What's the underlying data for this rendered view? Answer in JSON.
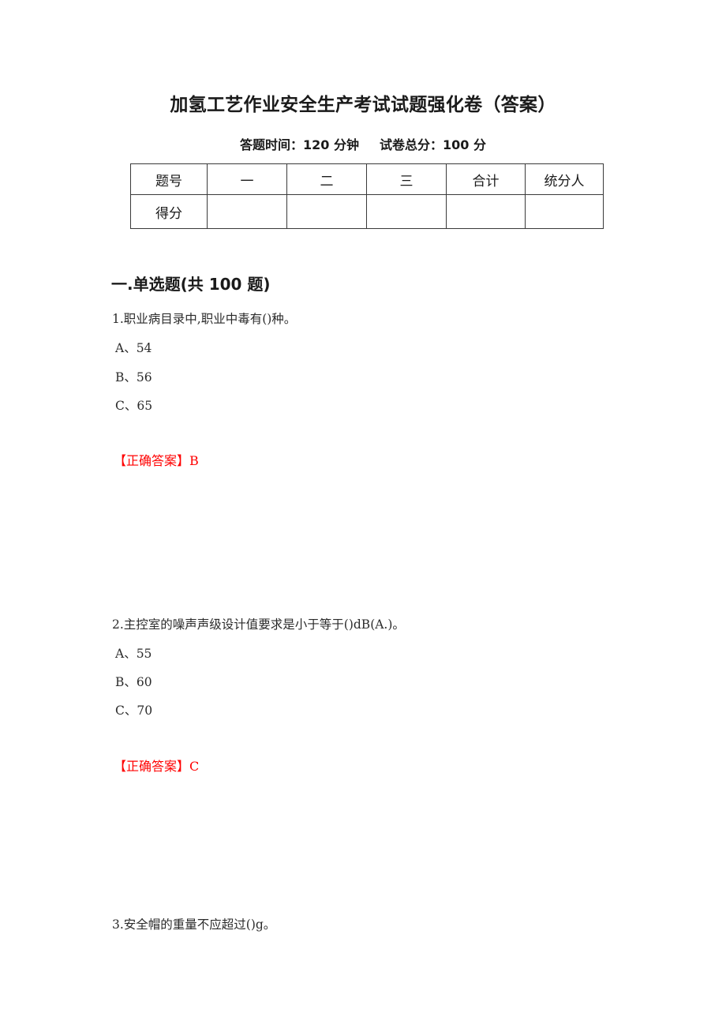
{
  "document": {
    "title": "加氢工艺作业安全生产考试试题强化卷（答案）",
    "exam_time_label": "答题时间：120 分钟",
    "total_score_label": "试卷总分：100 分"
  },
  "score_table": {
    "header_row": [
      "题号",
      "一",
      "二",
      "三",
      "合计",
      "统分人"
    ],
    "data_row": [
      "得分",
      "",
      "",
      "",
      "",
      ""
    ]
  },
  "sections": [
    {
      "heading": "一.单选题(共 100 题)"
    }
  ],
  "questions": [
    {
      "number": "1",
      "text": "1.职业病目录中,职业中毒有()种。",
      "options": [
        "A、54",
        "B、56",
        "C、65"
      ],
      "answer_line": "【正确答案】B"
    },
    {
      "number": "2",
      "text": "2.主控室的噪声声级设计值要求是小于等于()dB(A.)。",
      "options": [
        "A、55",
        "B、60",
        "C、70"
      ],
      "answer_line": "【正确答案】C"
    },
    {
      "number": "3",
      "text": "3.安全帽的重量不应超过()g。",
      "options": [],
      "answer_line": ""
    }
  ],
  "colors": {
    "answer_red": "#ff0000",
    "text_black": "#1a1a1a",
    "table_border": "#3a3a3a"
  }
}
